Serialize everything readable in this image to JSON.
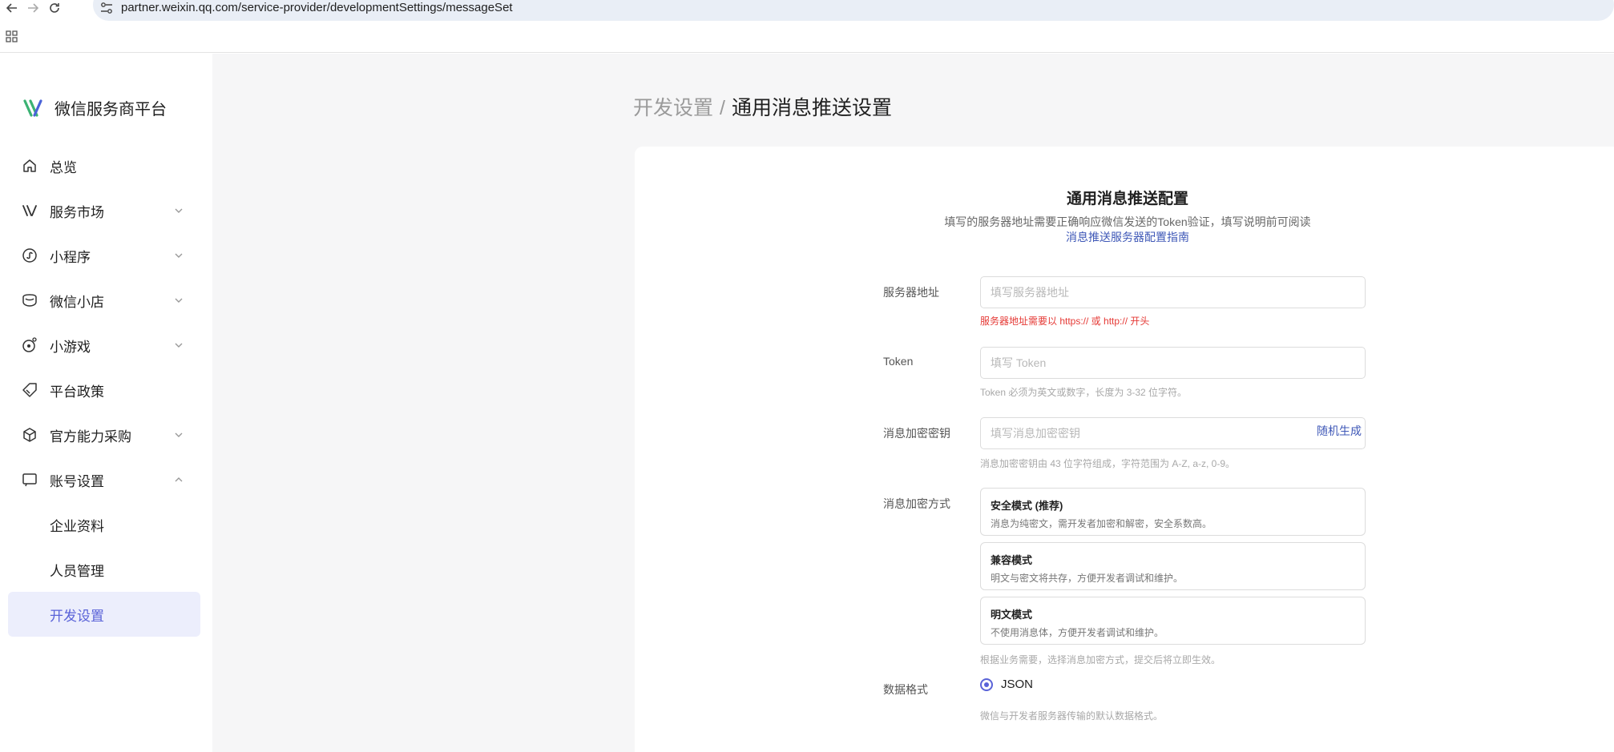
{
  "browser": {
    "url": "partner.weixin.qq.com/service-provider/developmentSettings/messageSet",
    "icons": [
      "back-icon",
      "forward-icon",
      "reload-icon",
      "site-settings-icon",
      "apps-grid-icon"
    ]
  },
  "sidebar": {
    "brand": "微信服务商平台",
    "items": [
      {
        "label": "总览",
        "icon": "home-icon",
        "expandable": false
      },
      {
        "label": "服务市场",
        "icon": "market-icon",
        "expandable": true
      },
      {
        "label": "小程序",
        "icon": "mini-program-icon",
        "expandable": true
      },
      {
        "label": "微信小店",
        "icon": "shop-icon",
        "expandable": true
      },
      {
        "label": "小游戏",
        "icon": "game-icon",
        "expandable": true
      },
      {
        "label": "平台政策",
        "icon": "policy-icon",
        "expandable": false
      },
      {
        "label": "官方能力采购",
        "icon": "box-icon",
        "expandable": true
      },
      {
        "label": "账号设置",
        "icon": "account-icon",
        "expandable": true,
        "expanded": true
      },
      {
        "label": "企业资料",
        "sub": true
      },
      {
        "label": "人员管理",
        "sub": true
      },
      {
        "label": "开发设置",
        "sub": true,
        "active": true
      }
    ]
  },
  "breadcrumb": {
    "parent": "开发设置",
    "separator": "/",
    "current": "通用消息推送设置"
  },
  "form": {
    "title": "通用消息推送配置",
    "subtitle": "填写的服务器地址需要正确响应微信发送的Token验证，填写说明前可阅读",
    "guide_link": "消息推送服务器配置指南",
    "server_url": {
      "label": "服务器地址",
      "value": "",
      "placeholder": "填写服务器地址",
      "error": "服务器地址需要以 https:// 或 http:// 开头"
    },
    "token": {
      "label": "Token",
      "value": "",
      "placeholder": "填写 Token",
      "hint": "Token 必须为英文或数字，长度为 3-32 位字符。"
    },
    "aes_key": {
      "label": "消息加密密钥",
      "value": "",
      "placeholder": "填写消息加密密钥",
      "generate": "随机生成",
      "hint": "消息加密密钥由 43 位字符组成，字符范围为 A-Z, a-z, 0-9。"
    },
    "encrypt_mode": {
      "label": "消息加密方式",
      "options": [
        {
          "title": "安全模式 (推荐)",
          "desc": "消息为纯密文，需开发者加密和解密，安全系数高。"
        },
        {
          "title": "兼容模式",
          "desc": "明文与密文将共存，方便开发者调试和维护。"
        },
        {
          "title": "明文模式",
          "desc": "不使用消息体，方便开发者调试和维护。"
        }
      ],
      "hint": "根据业务需要，选择消息加密方式，提交后将立即生效。"
    },
    "data_format": {
      "label": "数据格式",
      "selected": "JSON",
      "hint": "微信与开发者服务器传输的默认数据格式。"
    }
  },
  "colors": {
    "accent": "#5a63d8",
    "link": "#3f58b7",
    "error": "#e53935",
    "active_bg": "#eceefc"
  }
}
